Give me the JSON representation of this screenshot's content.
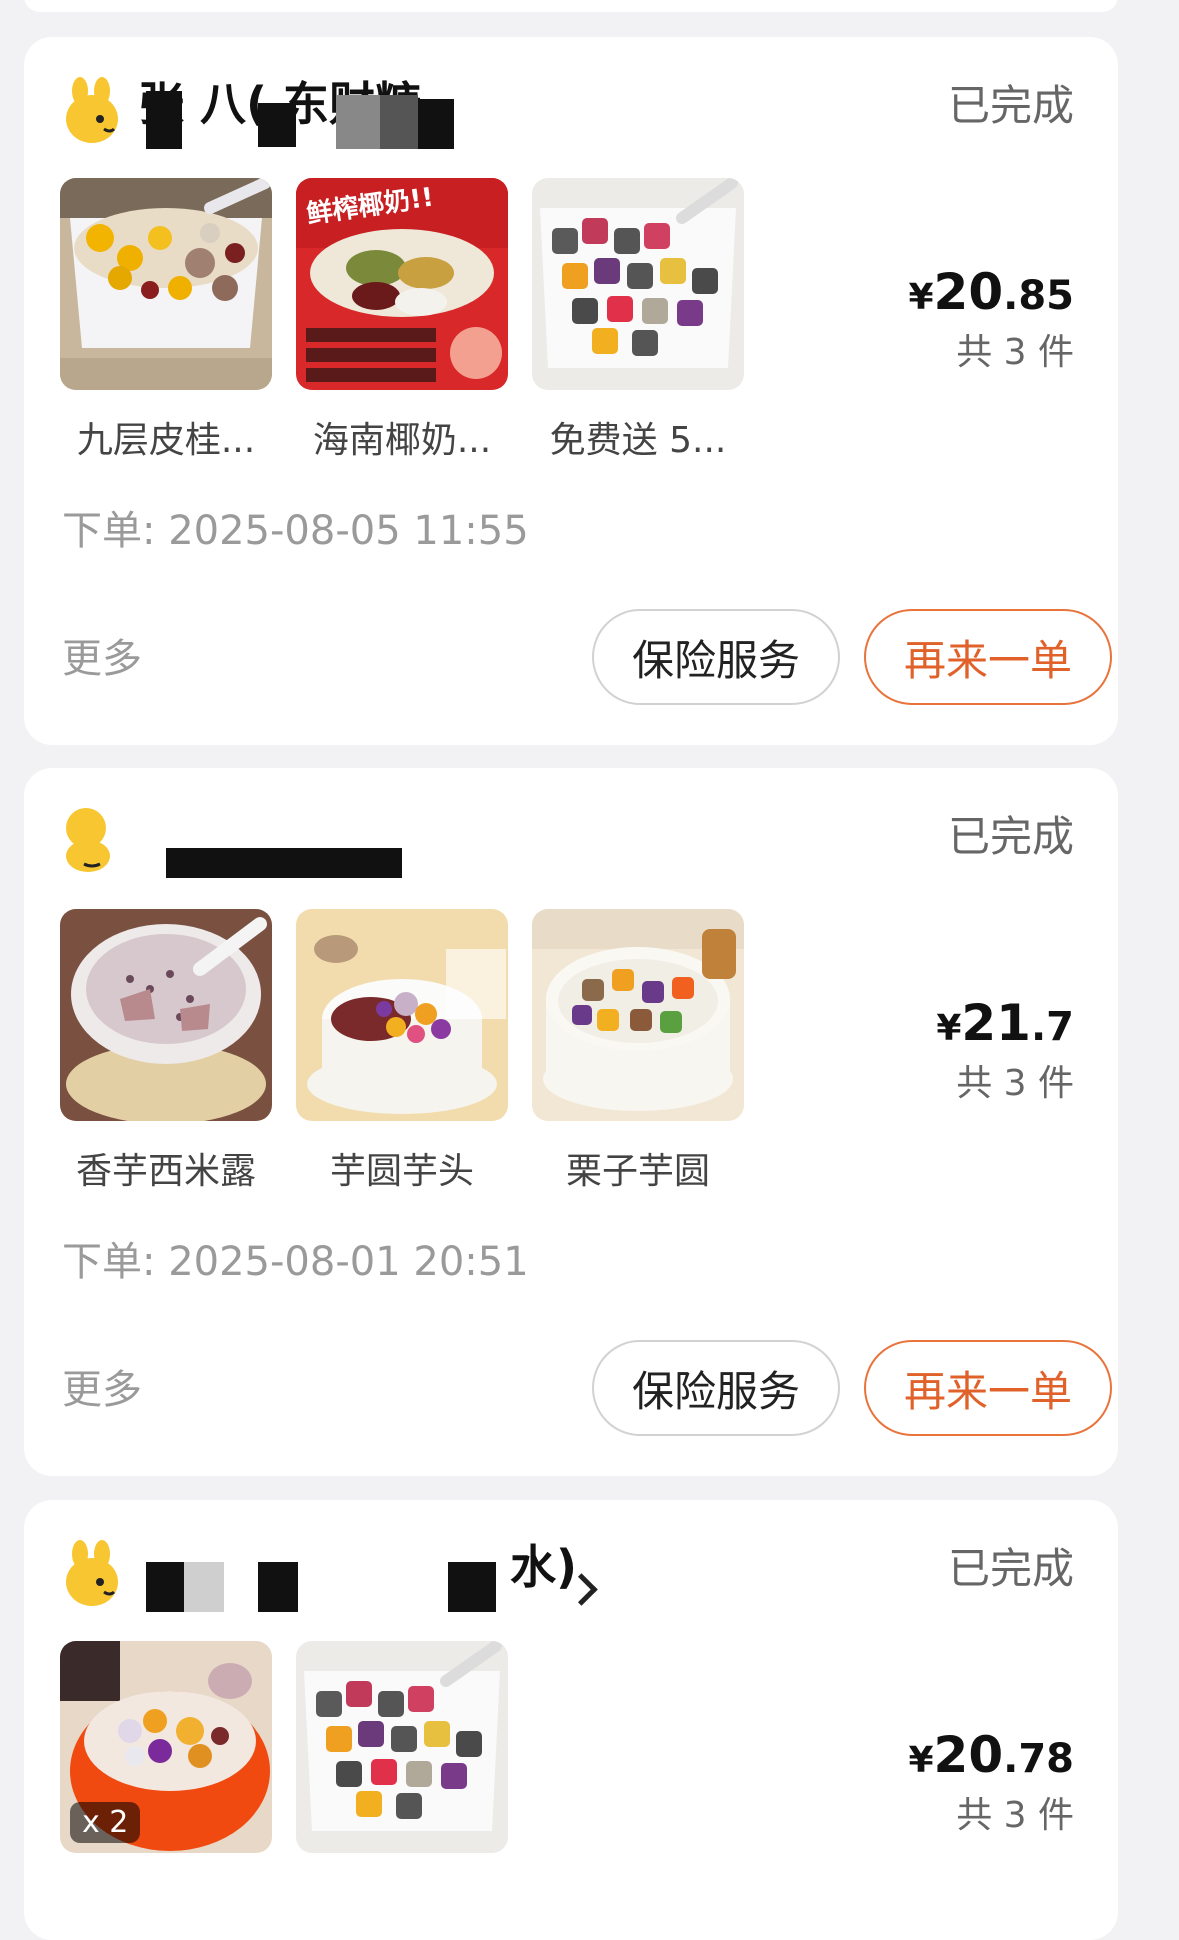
{
  "colors": {
    "accent": "#e0612a",
    "page_bg": "#f2f2f4",
    "brand_yellow": "#f7c631"
  },
  "orders": [
    {
      "shop_name_visible": "张 八( 东财糖",
      "status": "已完成",
      "items": [
        {
          "name": "九层皮桂...",
          "image": "dessert-bowl-sago-image"
        },
        {
          "name": "海南椰奶...",
          "image": "coconut-milk-promo-image"
        },
        {
          "name": "免费送 5...",
          "image": "taro-balls-bowl-image"
        }
      ],
      "price": {
        "symbol": "¥",
        "integer": "20",
        "decimal": ".85"
      },
      "count": "共 3 件",
      "time": "下单: 2025-08-05 11:55",
      "more": "更多",
      "insurance_btn": "保险服务",
      "reorder_btn": "再来一单"
    },
    {
      "shop_name_visible": "",
      "status": "已完成",
      "items": [
        {
          "name": "香芋西米露",
          "image": "taro-sago-image"
        },
        {
          "name": "芋圆芋头",
          "image": "taro-balls-redbean-image"
        },
        {
          "name": "栗子芋圆",
          "image": "chestnut-taro-image"
        }
      ],
      "price": {
        "symbol": "¥",
        "integer": "21",
        "decimal": ".7"
      },
      "count": "共 3 件",
      "time": "下单: 2025-08-01 20:51",
      "more": "更多",
      "insurance_btn": "保险服务",
      "reorder_btn": "再来一单"
    },
    {
      "shop_name_visible": "水)",
      "status": "已完成",
      "items": [
        {
          "name": "",
          "image": "orange-bowl-dessert-image",
          "quantity": "x 2"
        },
        {
          "name": "",
          "image": "taro-balls-bowl-image"
        }
      ],
      "price": {
        "symbol": "¥",
        "integer": "20",
        "decimal": ".78"
      },
      "count": "共 3 件"
    }
  ]
}
